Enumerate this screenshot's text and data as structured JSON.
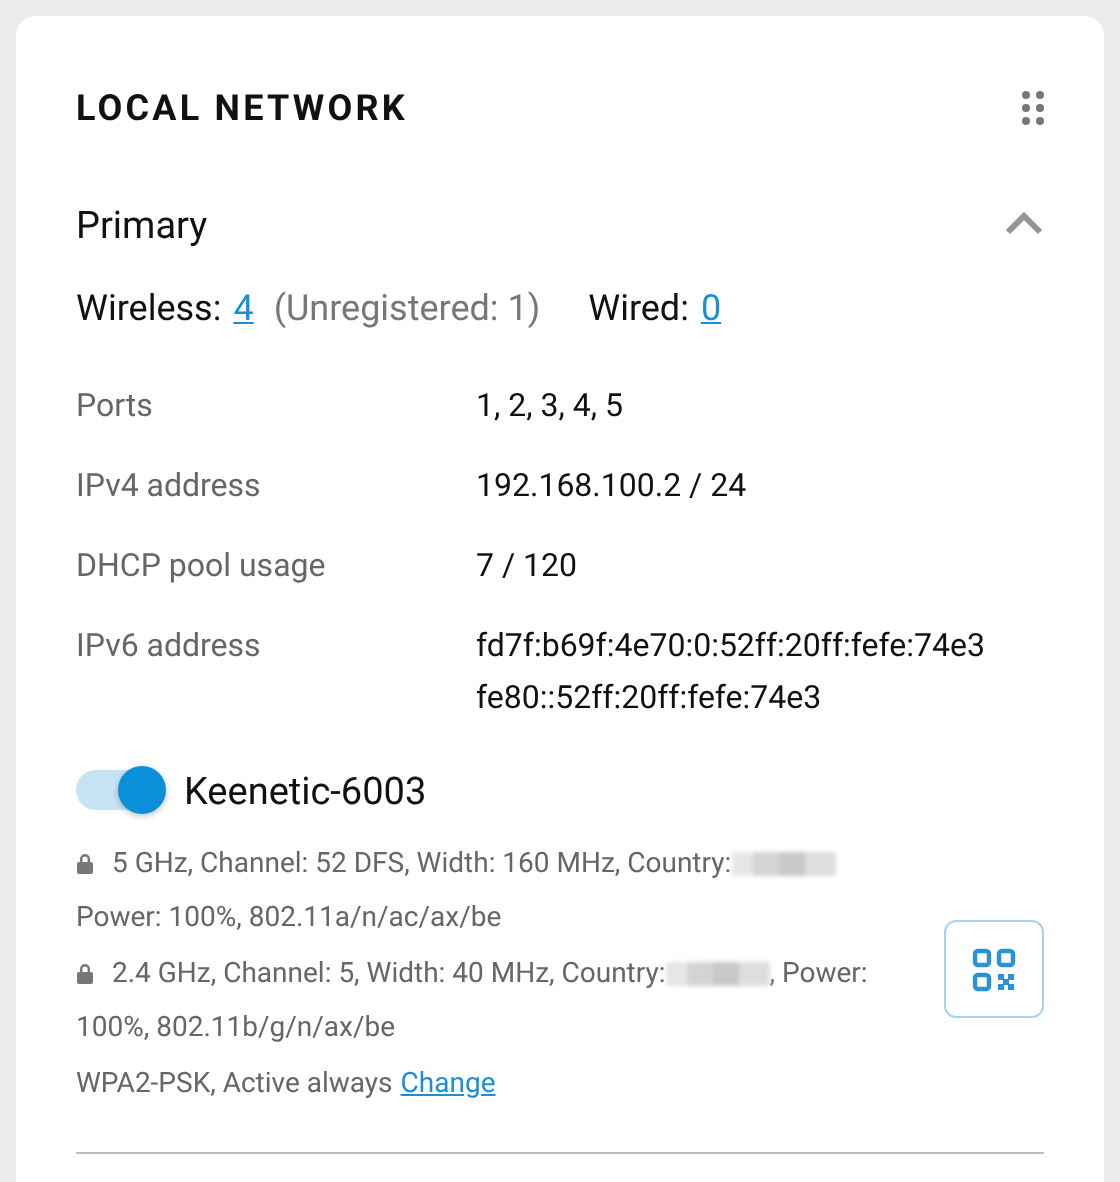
{
  "card": {
    "title": "LOCAL NETWORK"
  },
  "segment": {
    "name": "Primary",
    "expanded": true,
    "clients": {
      "wireless_label": "Wireless:",
      "wireless_count": "4",
      "unregistered": "(Unregistered: 1)",
      "wired_label": "Wired:",
      "wired_count": "0"
    },
    "details": [
      {
        "label": "Ports",
        "values": [
          "1, 2, 3, 4, 5"
        ]
      },
      {
        "label": "IPv4 address",
        "values": [
          "192.168.100.2 / 24"
        ]
      },
      {
        "label": "DHCP pool usage",
        "values": [
          "7 / 120"
        ]
      },
      {
        "label": "IPv6 address",
        "values": [
          "fd7f:b69f:4e70:0:52ff:20ff:fefe:74e3",
          "fe80::52ff:20ff:fefe:74e3"
        ]
      }
    ],
    "wifi": {
      "on": true,
      "ssid": "Keenetic-6003",
      "bands": [
        {
          "line1_before": "5 GHz, Channel: 52 DFS, Width: 160 MHz, Country:",
          "line2": "Power: 100%, 802.11a/n/ac/ax/be"
        },
        {
          "line1_before": "2.4 GHz, Channel: 5, Width: 40 MHz, Country:",
          "line1_after": ", Power:",
          "line2": "100%, 802.11b/g/n/ax/be"
        }
      ],
      "security": "WPA2-PSK, Active always",
      "change_link": "Change"
    }
  }
}
